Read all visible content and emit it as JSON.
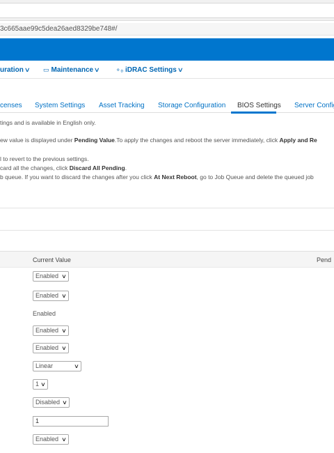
{
  "browser": {
    "url_fragment": "3c665aae99c5dea26aed8329be748#/"
  },
  "menu": {
    "configuration_label": "uration",
    "maintenance_label": "Maintenance",
    "idrac_label": "iDRAC Settings",
    "chevron": "∨",
    "maintenance_icon": "▭",
    "idrac_icon": "⚬ₒ"
  },
  "tabs": [
    {
      "label": "censes"
    },
    {
      "label": "System Settings"
    },
    {
      "label": "Asset Tracking"
    },
    {
      "label": "Storage Configuration"
    },
    {
      "label": "BIOS Settings",
      "active": true
    },
    {
      "label": "Server Configu"
    }
  ],
  "info": {
    "line1": "tings and is available in English only.",
    "line2_pre": "ew value is displayed under ",
    "line2_bold1": "Pending Value",
    "line2_mid": ".To apply the changes and reboot the server immediately, click ",
    "line2_bold2": "Apply and Re",
    "line3": "l to revert to the previous settings.",
    "line4_pre": "card all the changes, click ",
    "line4_bold": "Discard All Pending",
    "line4_post": ".",
    "line5_pre": "b queue. If you want to discard the changes after you click ",
    "line5_bold": "At Next Reboot",
    "line5_post": ", go to Job Queue and delete the queued job"
  },
  "grid": {
    "current_value_header": "Current Value",
    "pending_header": "Pend"
  },
  "rows": [
    {
      "type": "select",
      "value": "Enabled"
    },
    {
      "type": "select",
      "value": "Enabled"
    },
    {
      "type": "static",
      "value": "Enabled"
    },
    {
      "type": "select",
      "value": "Enabled"
    },
    {
      "type": "select",
      "value": "Enabled"
    },
    {
      "type": "select",
      "value": "Linear"
    },
    {
      "type": "select",
      "value": "1"
    },
    {
      "type": "select",
      "value": "Disabled"
    },
    {
      "type": "text",
      "value": "1"
    },
    {
      "type": "select",
      "value": "Enabled"
    }
  ],
  "colors": {
    "brand_blue": "#0076ce",
    "link_blue": "#0071c5"
  }
}
